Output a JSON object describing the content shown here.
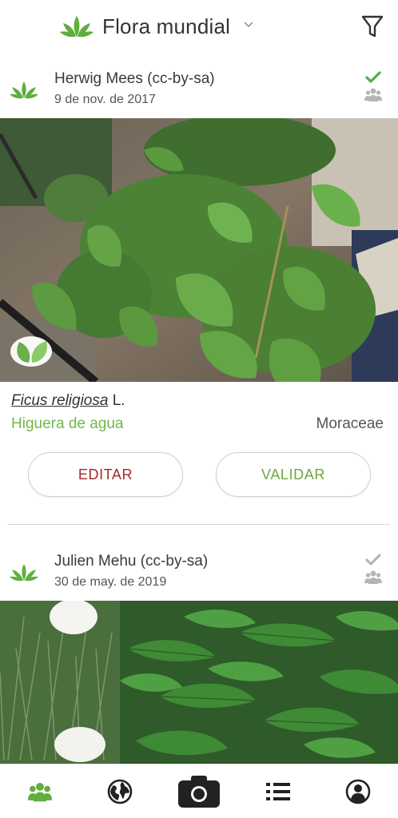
{
  "header": {
    "title": "Flora mundial"
  },
  "observations": [
    {
      "author": "Herwig Mees (cc-by-sa)",
      "date": "9 de nov. de 2017",
      "validated": true,
      "scientific_name": "Ficus religiosa",
      "scientific_author": "L.",
      "common_name": "Higuera de agua",
      "family": "Moraceae",
      "edit_label": "EDITAR",
      "validate_label": "VALIDAR"
    },
    {
      "author": "Julien Mehu (cc-by-sa)",
      "date": "30 de may. de 2019",
      "validated": false
    }
  ],
  "bottom_nav": [
    {
      "icon": "users-icon"
    },
    {
      "icon": "globe-icon"
    },
    {
      "icon": "camera-icon"
    },
    {
      "icon": "list-icon"
    },
    {
      "icon": "account-icon"
    }
  ],
  "colors": {
    "brand_green": "#72b84a",
    "edit_red": "#a8282a",
    "validated_check": "#4caf50",
    "muted_icon": "#b5b5b5"
  }
}
